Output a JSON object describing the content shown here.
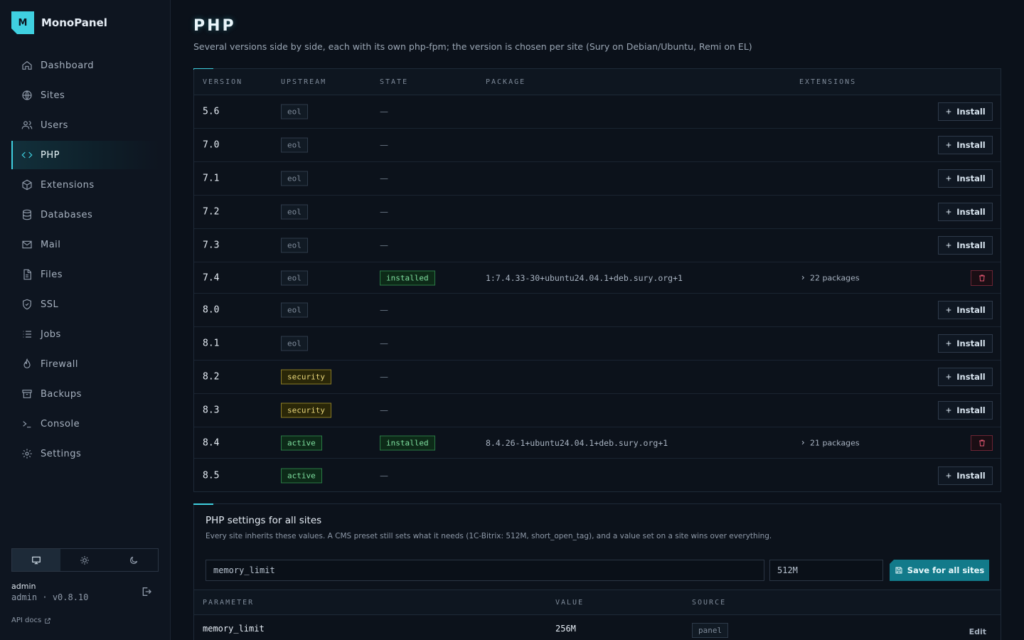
{
  "brand": {
    "logo": "M",
    "name": "MonoPanel"
  },
  "nav": [
    {
      "label": "Dashboard",
      "icon": "home-icon"
    },
    {
      "label": "Sites",
      "icon": "globe-icon"
    },
    {
      "label": "Users",
      "icon": "users-icon"
    },
    {
      "label": "PHP",
      "icon": "code-icon",
      "active": true
    },
    {
      "label": "Extensions",
      "icon": "cube-icon"
    },
    {
      "label": "Databases",
      "icon": "database-icon"
    },
    {
      "label": "Mail",
      "icon": "mail-icon"
    },
    {
      "label": "Files",
      "icon": "file-icon"
    },
    {
      "label": "SSL",
      "icon": "shield-icon"
    },
    {
      "label": "Jobs",
      "icon": "list-icon"
    },
    {
      "label": "Firewall",
      "icon": "flame-icon"
    },
    {
      "label": "Backups",
      "icon": "archive-icon"
    },
    {
      "label": "Console",
      "icon": "terminal-icon"
    },
    {
      "label": "Settings",
      "icon": "gear-icon"
    }
  ],
  "user": {
    "name": "admin",
    "role": "admin",
    "version": "v0.8.10"
  },
  "api_docs": "API docs",
  "page": {
    "title": "PHP",
    "subtitle": "Several versions side by side, each with its own php-fpm; the version is chosen per site (Sury on Debian/Ubuntu, Remi on EL)"
  },
  "versions_table": {
    "headers": {
      "version": "VERSION",
      "upstream": "UPSTREAM",
      "state": "STATE",
      "package": "PACKAGE",
      "extensions": "EXTENSIONS"
    },
    "install_label": "Install",
    "rows": [
      {
        "version": "5.6",
        "upstream": "eol",
        "state": "—"
      },
      {
        "version": "7.0",
        "upstream": "eol",
        "state": "—"
      },
      {
        "version": "7.1",
        "upstream": "eol",
        "state": "—"
      },
      {
        "version": "7.2",
        "upstream": "eol",
        "state": "—"
      },
      {
        "version": "7.3",
        "upstream": "eol",
        "state": "—"
      },
      {
        "version": "7.4",
        "upstream": "eol",
        "state": "installed",
        "package": "1:7.4.33-30+ubuntu24.04.1+deb.sury.org+1",
        "extensions": "22 packages"
      },
      {
        "version": "8.0",
        "upstream": "eol",
        "state": "—"
      },
      {
        "version": "8.1",
        "upstream": "eol",
        "state": "—"
      },
      {
        "version": "8.2",
        "upstream": "security",
        "state": "—"
      },
      {
        "version": "8.3",
        "upstream": "security",
        "state": "—"
      },
      {
        "version": "8.4",
        "upstream": "active",
        "state": "installed",
        "package": "8.4.26-1+ubuntu24.04.1+deb.sury.org+1",
        "extensions": "21 packages"
      },
      {
        "version": "8.5",
        "upstream": "active",
        "state": "—"
      }
    ]
  },
  "settings": {
    "title": "PHP settings for all sites",
    "description": "Every site inherits these values. A CMS preset still sets what it needs (1C-Bitrix: 512M, short_open_tag), and a value set on a site wins over everything.",
    "param_input": "memory_limit",
    "value_input": "512M",
    "save_label": "Save for all sites",
    "headers": {
      "parameter": "PARAMETER",
      "value": "VALUE",
      "source": "SOURCE"
    },
    "rows": [
      {
        "parameter": "memory_limit",
        "value": "256M",
        "source": "panel",
        "action": "Edit"
      }
    ]
  },
  "colors": {
    "accent": "#3fd0e0",
    "eol": "#7f8b9a",
    "security": "#e9d77a",
    "active": "#7fe0a0",
    "danger": "#e0556f"
  }
}
